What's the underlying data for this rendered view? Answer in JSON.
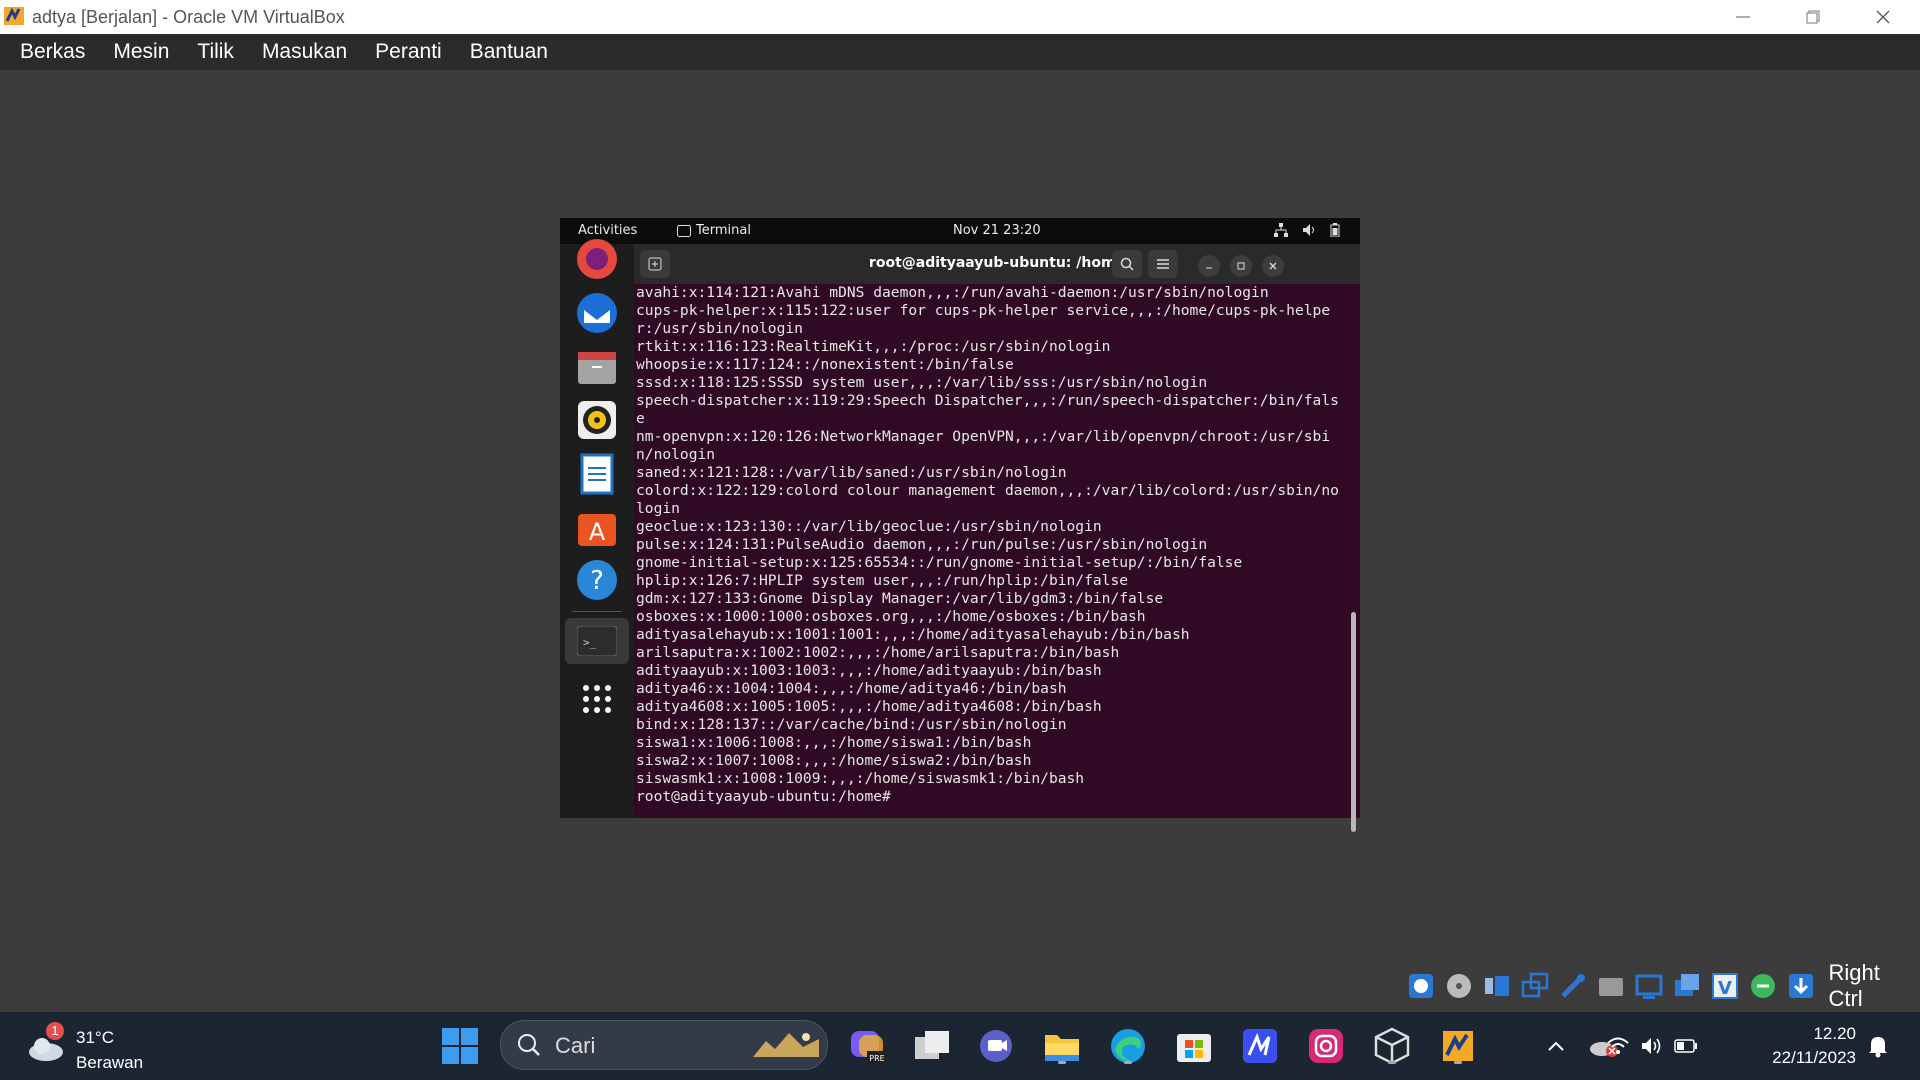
{
  "window": {
    "title": "adtya [Berjalan] - Oracle VM VirtualBox"
  },
  "menu": [
    "Berkas",
    "Mesin",
    "Tilik",
    "Masukan",
    "Peranti",
    "Bantuan"
  ],
  "vm": {
    "topbar": {
      "activities": "Activities",
      "app": "Terminal",
      "datetime": "Nov 21  23:20"
    },
    "dock": [
      "firefox-icon",
      "thunderbird-icon",
      "files-icon",
      "rhythmbox-icon",
      "libreoffice-writer-icon",
      "app-center-icon",
      "help-icon",
      "terminal-icon",
      "show-apps-icon"
    ],
    "terminal": {
      "title": "root@adityaayub-ubuntu: /home",
      "lines": [
        "avahi:x:114:121:Avahi mDNS daemon,,,:/run/avahi-daemon:/usr/sbin/nologin",
        "cups-pk-helper:x:115:122:user for cups-pk-helper service,,,:/home/cups-pk-helper:/usr/sbin/nologin",
        "rtkit:x:116:123:RealtimeKit,,,:/proc:/usr/sbin/nologin",
        "whoopsie:x:117:124::/nonexistent:/bin/false",
        "sssd:x:118:125:SSSD system user,,,:/var/lib/sss:/usr/sbin/nologin",
        "speech-dispatcher:x:119:29:Speech Dispatcher,,,:/run/speech-dispatcher:/bin/false",
        "nm-openvpn:x:120:126:NetworkManager OpenVPN,,,:/var/lib/openvpn/chroot:/usr/sbin/nologin",
        "saned:x:121:128::/var/lib/saned:/usr/sbin/nologin",
        "colord:x:122:129:colord colour management daemon,,,:/var/lib/colord:/usr/sbin/nologin",
        "geoclue:x:123:130::/var/lib/geoclue:/usr/sbin/nologin",
        "pulse:x:124:131:PulseAudio daemon,,,:/run/pulse:/usr/sbin/nologin",
        "gnome-initial-setup:x:125:65534::/run/gnome-initial-setup/:/bin/false",
        "hplip:x:126:7:HPLIP system user,,,:/run/hplip:/bin/false",
        "gdm:x:127:133:Gnome Display Manager:/var/lib/gdm3:/bin/false",
        "osboxes:x:1000:1000:osboxes.org,,,:/home/osboxes:/bin/bash",
        "adityasalehayub:x:1001:1001:,,,:/home/adityasalehayub:/bin/bash",
        "arilsaputra:x:1002:1002:,,,:/home/arilsaputra:/bin/bash",
        "adityaayub:x:1003:1003:,,,:/home/adityaayub:/bin/bash",
        "aditya46:x:1004:1004:,,,:/home/aditya46:/bin/bash",
        "aditya4608:x:1005:1005:,,,:/home/aditya4608:/bin/bash",
        "bind:x:128:137::/var/cache/bind:/usr/sbin/nologin",
        "siswa1:x:1006:1008:,,,:/home/siswa1:/bin/bash",
        "siswa2:x:1007:1008:,,,:/home/siswa2:/bin/bash",
        "siswasmk1:x:1008:1009:,,,:/home/siswasmk1:/bin/bash",
        "root@adityaayub-ubuntu:/home# "
      ]
    }
  },
  "statusbar": {
    "host_key": "Right Ctrl"
  },
  "taskbar": {
    "weather": {
      "badge": "1",
      "temp": "31°C",
      "condition": "Berawan"
    },
    "search_placeholder": "Cari",
    "time": "12.20",
    "date": "22/11/2023"
  }
}
